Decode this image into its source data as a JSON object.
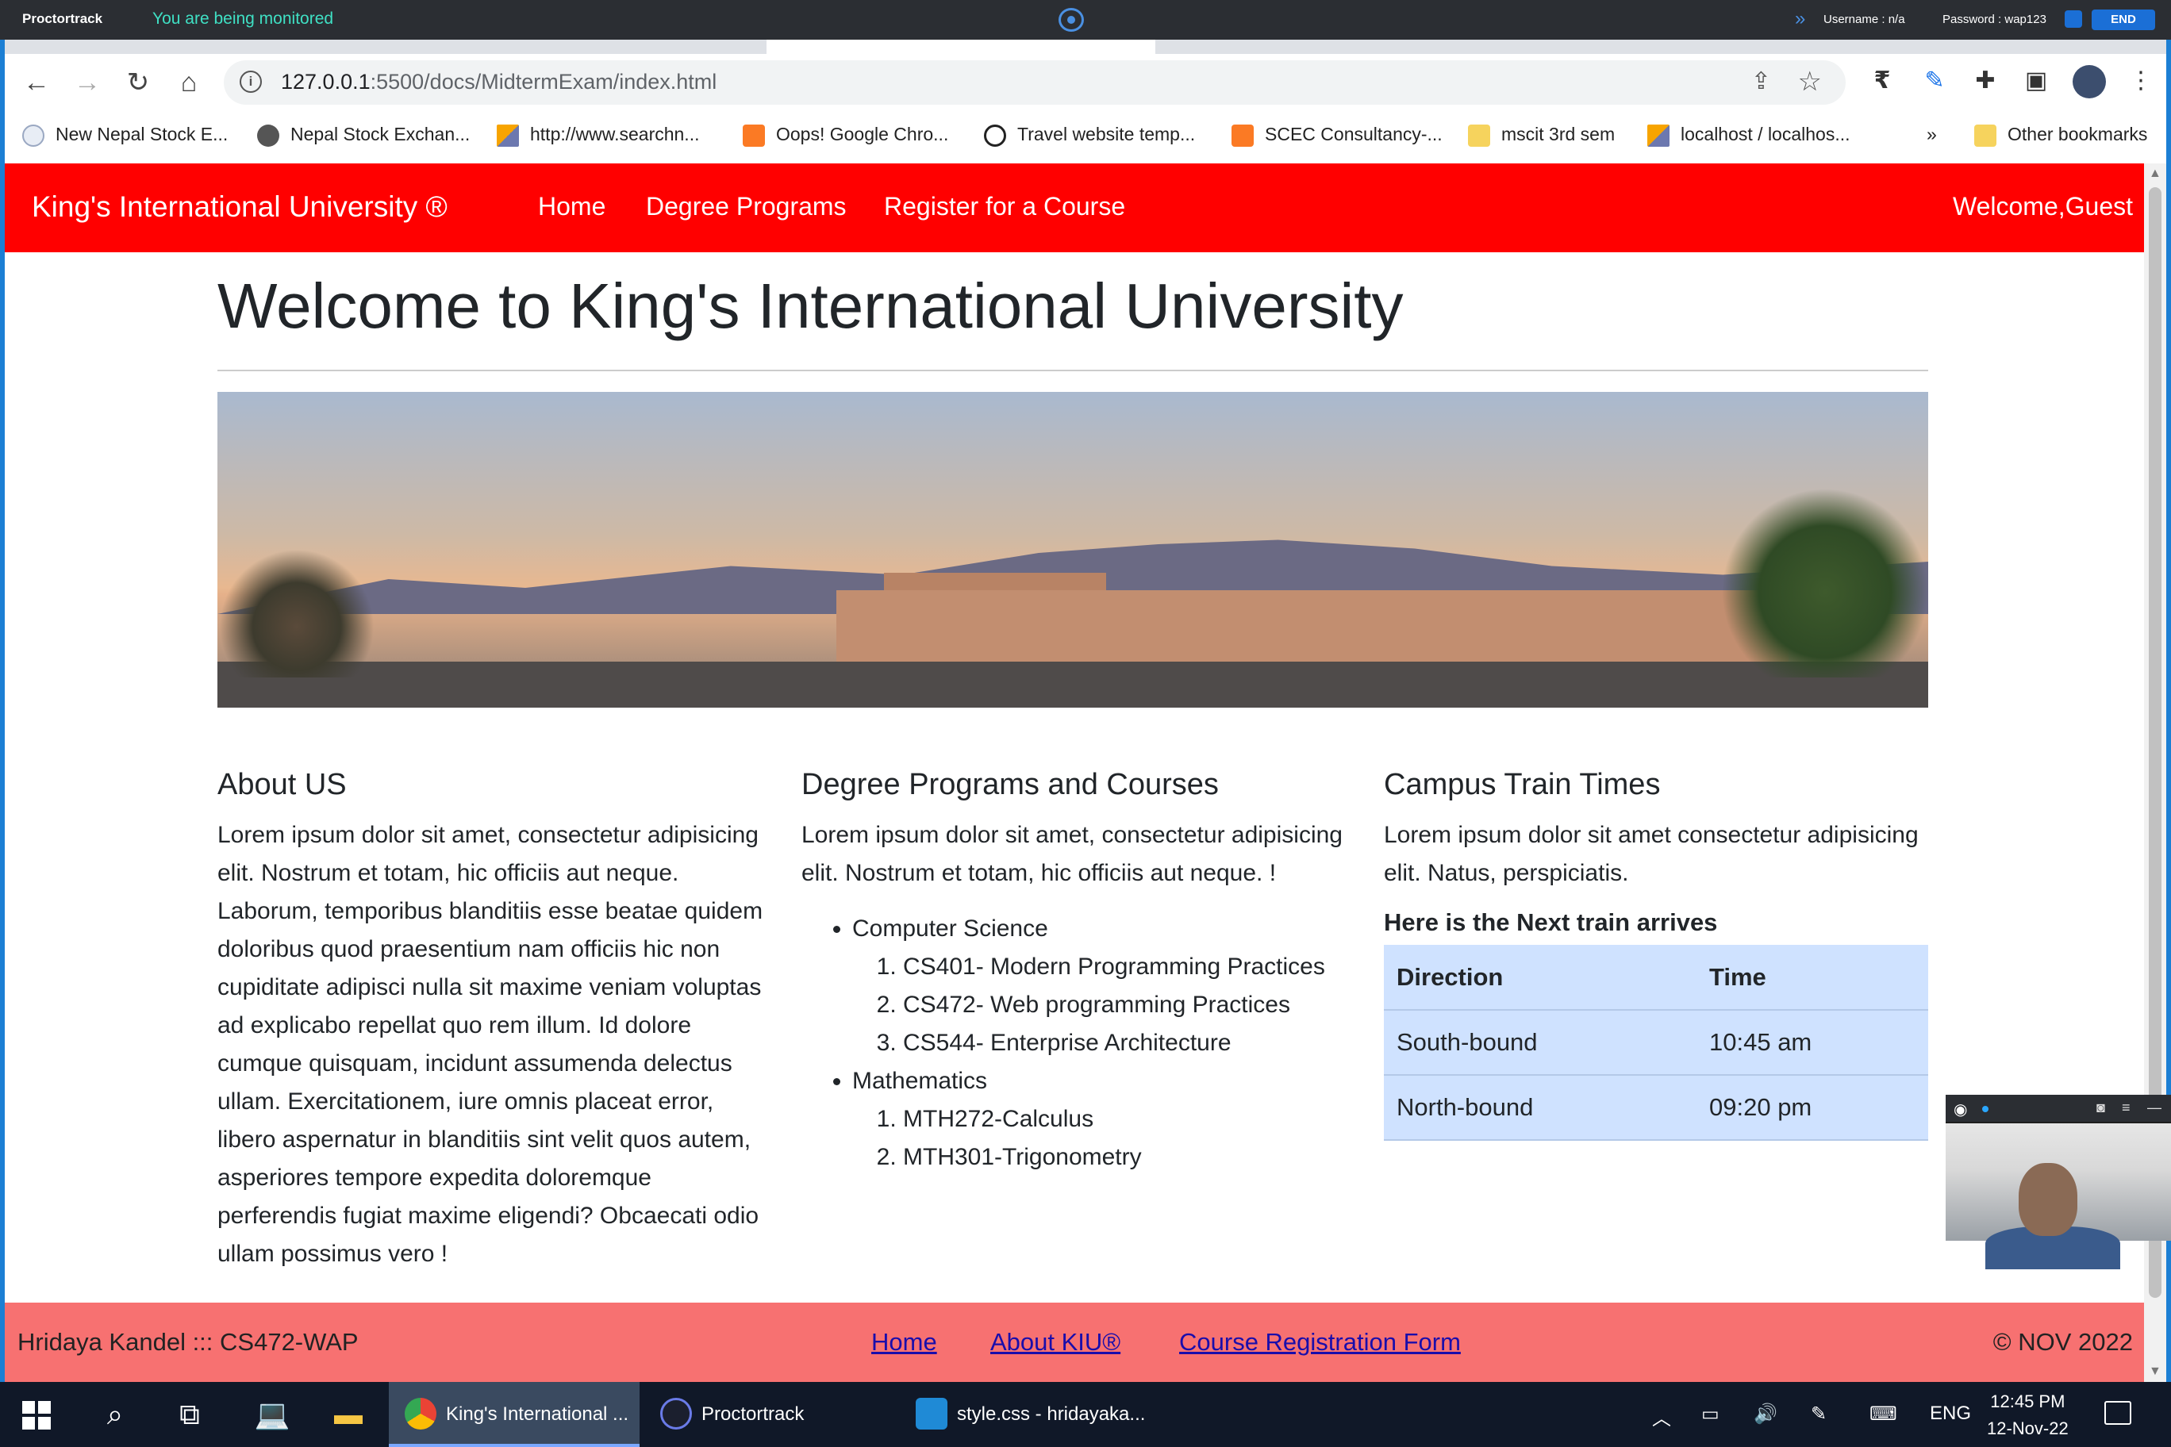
{
  "proctor": {
    "brand": "Proctortrack",
    "monitored": "You are being monitored",
    "username": "Username : n/a",
    "password": "Password : wap123",
    "end": "END"
  },
  "browser": {
    "url_host": "127.0.0.1",
    "url_rest": ":5500/docs/MidtermExam/index.html",
    "bookmarks": [
      {
        "label": "New Nepal Stock E...",
        "icon": "globe-icon"
      },
      {
        "label": "Nepal Stock Exchan...",
        "icon": "world-icon"
      },
      {
        "label": "http://www.searchn...",
        "icon": "phpmyadmin-icon"
      },
      {
        "label": "Oops! Google Chro...",
        "icon": "xampp-icon"
      },
      {
        "label": "Travel website temp...",
        "icon": "download-icon"
      },
      {
        "label": "SCEC Consultancy-...",
        "icon": "xampp-icon"
      },
      {
        "label": "mscit 3rd sem",
        "icon": "folder-icon"
      },
      {
        "label": "localhost / localhos...",
        "icon": "phpmyadmin-icon"
      }
    ],
    "more": "»",
    "other_bookmarks": "Other bookmarks"
  },
  "site": {
    "brand": "King's International University ®",
    "nav": [
      "Home",
      "Degree Programs",
      "Register for a Course"
    ],
    "welcome": "Welcome,Guest",
    "title": "Welcome to King's International University",
    "about": {
      "heading": "About US",
      "text": "Lorem ipsum dolor sit amet, consectetur adipisicing elit. Nostrum et totam, hic officiis aut neque. Laborum, temporibus blanditiis esse beatae quidem doloribus quod praesentium nam officiis hic non cupiditate adipisci nulla sit maxime veniam voluptas ad explicabo repellat quo rem illum. Id dolore cumque quisquam, incidunt assumenda delectus ullam. Exercitationem, iure omnis placeat error, libero aspernatur in blanditiis sint velit quos autem, asperiores tempore expedita doloremque perferendis fugiat maxime eligendi? Obcaecati odio ullam possimus vero !"
    },
    "degrees": {
      "heading": "Degree Programs and Courses",
      "text": "Lorem ipsum dolor sit amet, consectetur adipisicing elit. Nostrum et totam, hic officiis aut neque. !",
      "programs": [
        {
          "name": "Computer Science",
          "courses": [
            "CS401- Modern Programming Practices",
            "CS472- Web programming Practices",
            "CS544- Enterprise Architecture"
          ]
        },
        {
          "name": "Mathematics",
          "courses": [
            "MTH272-Calculus",
            "MTH301-Trigonometry"
          ]
        }
      ]
    },
    "train": {
      "heading": "Campus Train Times",
      "text": "Lorem ipsum dolor sit amet consectetur adipisicing elit. Natus, perspiciatis.",
      "subheading": "Here is the Next train arrives",
      "columns": [
        "Direction",
        "Time"
      ],
      "rows": [
        [
          "South-bound",
          "10:45 am"
        ],
        [
          "North-bound",
          "09:20 pm"
        ]
      ]
    },
    "footer": {
      "left": "Hridaya Kandel ::: CS472-WAP",
      "links": [
        "Home",
        "About KIU®",
        "Course Registration Form"
      ],
      "right": "© NOV 2022"
    }
  },
  "taskbar": {
    "apps": [
      {
        "label": "King's International ...",
        "active": true
      },
      {
        "label": "Proctortrack",
        "active": false
      },
      {
        "label": "style.css - hridayaka...",
        "active": false
      }
    ],
    "lang": "ENG",
    "time": "12:45 PM",
    "date": "12-Nov-22"
  }
}
